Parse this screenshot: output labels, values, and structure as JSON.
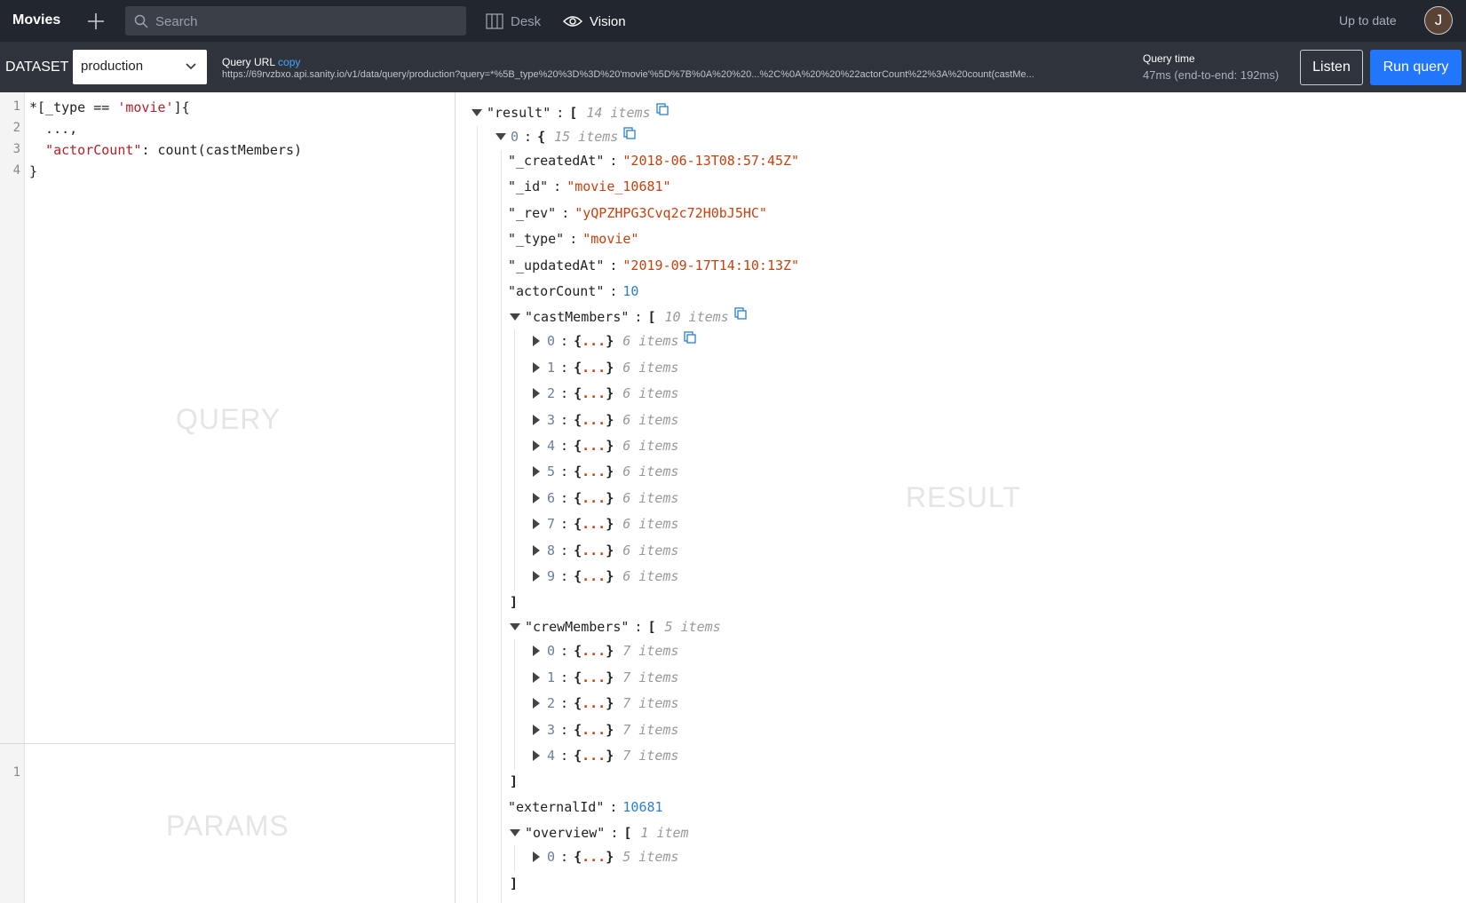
{
  "app": {
    "title": "Movies",
    "status": "Up to date",
    "avatar_initial": "J"
  },
  "search": {
    "placeholder": "Search"
  },
  "nav": {
    "desk": "Desk",
    "vision": "Vision"
  },
  "toolbar": {
    "dataset_label": "DATASET",
    "dataset_value": "production",
    "query_url_label": "Query URL",
    "query_url_copy": "copy",
    "query_url": "https://69rvzbxo.api.sanity.io/v1/data/query/production?query=*%5B_type%20%3D%3D%20'movie'%5D%7B%0A%20%20...%2C%0A%20%20%22actorCount%22%3A%20count(castMe...",
    "query_time_label": "Query time",
    "query_time": "47ms (end-to-end: 192ms)",
    "listen_label": "Listen",
    "run_label": "Run query"
  },
  "query_editor": {
    "lines": [
      {
        "n": "1",
        "parts": [
          [
            "*[_type == ",
            ""
          ],
          [
            "'movie'",
            "str"
          ],
          [
            "]{",
            ""
          ]
        ]
      },
      {
        "n": "2",
        "parts": [
          [
            "  ...,",
            ""
          ]
        ]
      },
      {
        "n": "3",
        "parts": [
          [
            "  ",
            ""
          ],
          [
            "\"actorCount\"",
            "str"
          ],
          [
            ": count(castMembers)",
            ""
          ]
        ]
      },
      {
        "n": "4",
        "parts": [
          [
            "}",
            ""
          ]
        ]
      }
    ],
    "ghost": "QUERY"
  },
  "params_editor": {
    "lines": [
      "1"
    ],
    "ghost": "PARAMS"
  },
  "result": {
    "ghost": "RESULT",
    "root_key": "\"result\"",
    "root_meta": "14 items",
    "item0_index": "0",
    "item0_meta": "15 items",
    "fields": [
      {
        "key": "\"_createdAt\"",
        "value": "\"2018-06-13T08:57:45Z\"",
        "type": "s"
      },
      {
        "key": "\"_id\"",
        "value": "\"movie_10681\"",
        "type": "s"
      },
      {
        "key": "\"_rev\"",
        "value": "\"yQPZHPG3Cvq2c72H0bJ5HC\"",
        "type": "s"
      },
      {
        "key": "\"_type\"",
        "value": "\"movie\"",
        "type": "s"
      },
      {
        "key": "\"_updatedAt\"",
        "value": "\"2019-09-17T14:10:13Z\"",
        "type": "s"
      },
      {
        "key": "\"actorCount\"",
        "value": "10",
        "type": "n"
      }
    ],
    "castMembers": {
      "key": "\"castMembers\"",
      "meta": "10 items",
      "items": [
        {
          "i": "0",
          "meta": "6 items"
        },
        {
          "i": "1",
          "meta": "6 items"
        },
        {
          "i": "2",
          "meta": "6 items"
        },
        {
          "i": "3",
          "meta": "6 items"
        },
        {
          "i": "4",
          "meta": "6 items"
        },
        {
          "i": "5",
          "meta": "6 items"
        },
        {
          "i": "6",
          "meta": "6 items"
        },
        {
          "i": "7",
          "meta": "6 items"
        },
        {
          "i": "8",
          "meta": "6 items"
        },
        {
          "i": "9",
          "meta": "6 items"
        }
      ]
    },
    "crewMembers": {
      "key": "\"crewMembers\"",
      "meta": "5 items",
      "items": [
        {
          "i": "0",
          "meta": "7 items"
        },
        {
          "i": "1",
          "meta": "7 items"
        },
        {
          "i": "2",
          "meta": "7 items"
        },
        {
          "i": "3",
          "meta": "7 items"
        },
        {
          "i": "4",
          "meta": "7 items"
        }
      ]
    },
    "externalId": {
      "key": "\"externalId\"",
      "value": "10681"
    },
    "overview": {
      "key": "\"overview\"",
      "meta": "1 item",
      "items": [
        {
          "i": "0",
          "meta": "5 items"
        }
      ]
    }
  }
}
